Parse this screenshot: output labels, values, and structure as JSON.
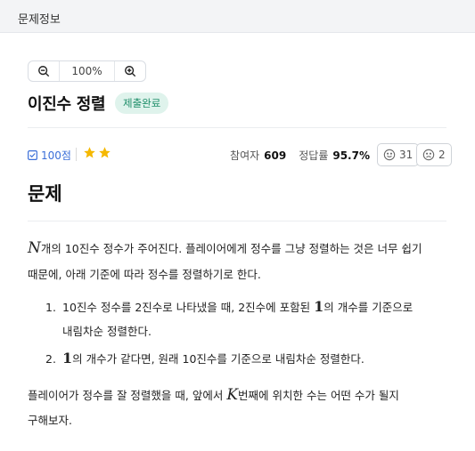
{
  "topbar": {
    "title": "문제정보"
  },
  "zoom": {
    "value": "100%",
    "zoom_out_icon": "zoom-out-icon",
    "zoom_in_icon": "zoom-in-icon"
  },
  "problem": {
    "title": "이진수 정렬",
    "status_badge": "제출완료",
    "score": "100점",
    "difficulty_stars": 2,
    "participants_label": "참여자",
    "participants_value": "609",
    "accuracy_label": "정답률",
    "accuracy_value": "95.7%",
    "like_count": "31",
    "dislike_count": "2"
  },
  "section": {
    "heading": "문제"
  },
  "statement": {
    "p1_var": "N",
    "p1_line1": "개의 10진수 정수가 주어진다. 플레이어에게 정수를 그냥 정렬하는 것은 너무 쉽기",
    "p1_line2": "때문에, 아래 기준에 따라 정수를 정렬하기로 한다.",
    "items": [
      {
        "num": "1.",
        "pre": "10진수 정수를 2진수로 나타냈을 때, 2진수에 포함된 ",
        "var": "1",
        "post": "의 개수를 기준으로",
        "line2": "내림차순 정렬한다."
      },
      {
        "num": "2.",
        "pre": "",
        "var": "1",
        "post": "의 개수가 같다면, 원래 10진수를 기준으로 내림차순 정렬한다.",
        "line2": ""
      }
    ],
    "p2_pre": "플레이어가 정수를 잘 정렬했을 때, 앞에서 ",
    "p2_var": "K",
    "p2_post": "번째에 위치한 수는 어떤 수가 될지",
    "p2_line2": "구해보자."
  },
  "colors": {
    "accent_blue": "#3b6fd8",
    "star": "#f5b800",
    "badge_bg": "#dff3ec",
    "badge_text": "#1f8f6a"
  }
}
